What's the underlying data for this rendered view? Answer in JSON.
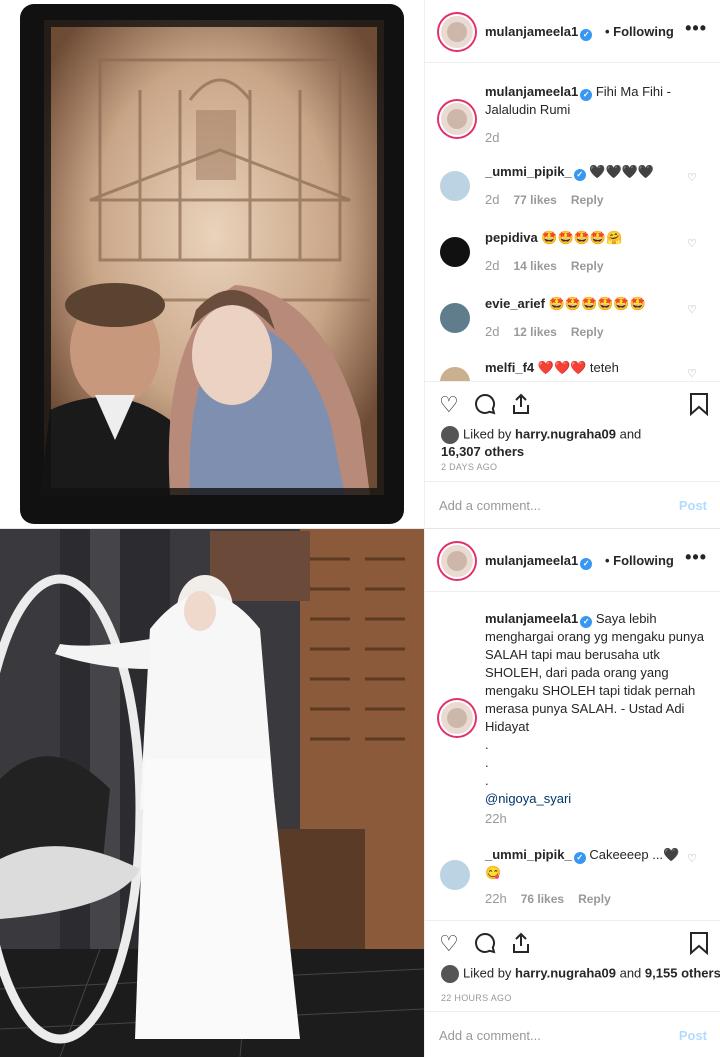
{
  "post1": {
    "username": "mulanjameela1",
    "follow_label": "Following",
    "more_label": "•••",
    "caption": "Fihi Ma Fihi - Jalaludin Rumi",
    "caption_time": "2d",
    "comments": [
      {
        "user": "_ummi_pipik_",
        "verified": true,
        "text": "🖤🖤🖤🖤",
        "time": "2d",
        "likes": "77 likes",
        "reply": "Reply"
      },
      {
        "user": "pepidiva",
        "verified": false,
        "text": "🤩🤩🤩🤩🤗",
        "time": "2d",
        "likes": "14 likes",
        "reply": "Reply"
      },
      {
        "user": "evie_arief",
        "verified": false,
        "text": "🤩🤩🤩🤩🤩🤩",
        "time": "2d",
        "likes": "12 likes",
        "reply": "Reply"
      },
      {
        "user": "melfi_f4",
        "verified": false,
        "text": "❤️❤️❤️ teteh",
        "time": "",
        "likes": "",
        "reply": ""
      }
    ],
    "liked_prefix": "Liked by",
    "liked_user": "harry.nugraha09",
    "liked_and": "and",
    "liked_others": "16,307 others",
    "time_ago": "2 DAYS AGO",
    "add_comment_placeholder": "Add a comment...",
    "post_label": "Post"
  },
  "post2": {
    "username": "mulanjameela1",
    "follow_label": "Following",
    "more_label": "•••",
    "caption": "Saya lebih menghargai orang yg mengaku punya SALAH tapi mau berusaha utk SHOLEH, dari pada orang yang mengaku SHOLEH tapi tidak pernah merasa punya SALAH. - Ustad Adi Hidayat",
    "caption_dots": ".",
    "caption_mention": "@nigoya_syari",
    "caption_time": "22h",
    "comments": [
      {
        "user": "_ummi_pipik_",
        "verified": true,
        "text": "Cakeeeep ...🖤 😋",
        "time": "22h",
        "likes": "76 likes",
        "reply": "Reply"
      }
    ],
    "liked_prefix": "Liked by",
    "liked_user": "harry.nugraha09",
    "liked_and": "and",
    "liked_others": "9,155 others",
    "time_ago": "22 HOURS AGO",
    "add_comment_placeholder": "Add a comment...",
    "post_label": "Post"
  },
  "icons": {
    "heart": "heart-icon",
    "comment": "comment-icon",
    "share": "share-icon",
    "bookmark": "bookmark-icon"
  }
}
